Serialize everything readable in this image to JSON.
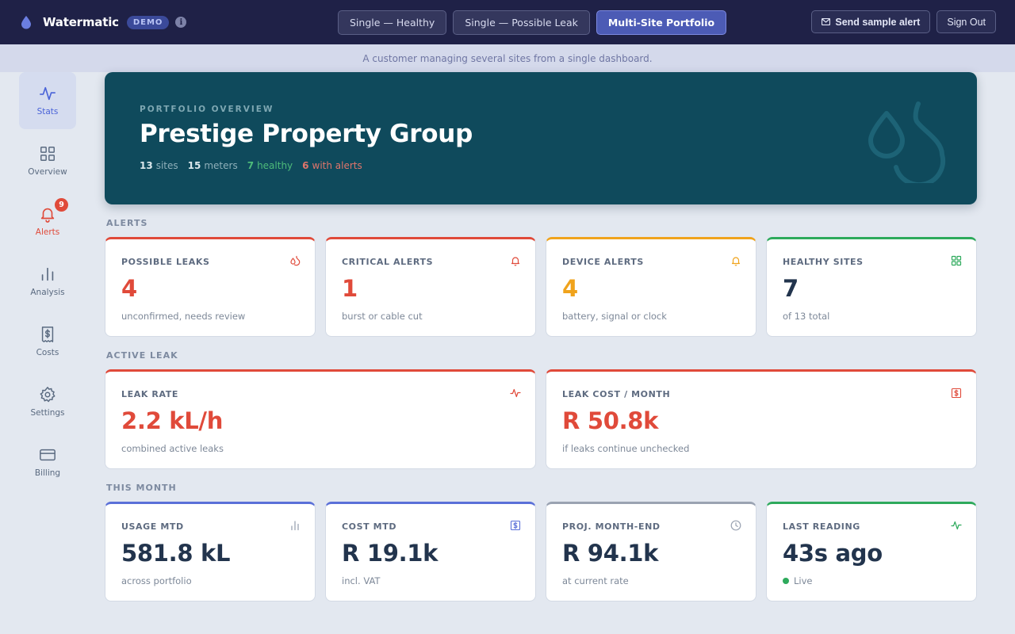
{
  "app": {
    "name": "Watermatic",
    "demo_badge": "DEMO",
    "info_glyph": "i"
  },
  "scenarios": [
    {
      "label": "Single — Healthy",
      "active": false
    },
    {
      "label": "Single — Possible Leak",
      "active": false
    },
    {
      "label": "Multi-Site Portfolio",
      "active": true
    }
  ],
  "actions": {
    "send_alert": "Send sample alert",
    "sign_out": "Sign Out"
  },
  "subtitle": "A customer managing several sites from a single dashboard.",
  "sidebar": {
    "items": [
      {
        "label": "Stats",
        "icon": "activity-icon"
      },
      {
        "label": "Overview",
        "icon": "grid-icon"
      },
      {
        "label": "Alerts",
        "icon": "bell-icon",
        "badge": "9"
      },
      {
        "label": "Analysis",
        "icon": "bar-chart-icon"
      },
      {
        "label": "Costs",
        "icon": "receipt-icon"
      },
      {
        "label": "Settings",
        "icon": "gear-icon"
      },
      {
        "label": "Billing",
        "icon": "credit-card-icon"
      }
    ]
  },
  "hero": {
    "eyebrow": "PORTFOLIO OVERVIEW",
    "title": "Prestige Property Group",
    "sites_count": "13",
    "sites_label": "sites",
    "meters_count": "15",
    "meters_label": "meters",
    "healthy_count": "7",
    "healthy_label": "healthy",
    "alerts_count": "6",
    "alerts_label": "with alerts"
  },
  "sections": {
    "alerts": "ALERTS",
    "active_leak": "ACTIVE LEAK",
    "this_month": "THIS MONTH"
  },
  "colors": {
    "red": "#e04a3a",
    "amber": "#f0a31c",
    "green": "#2eaa5c",
    "blue": "#5b70d8",
    "gray": "#9aa3b2",
    "navy": "#22344d"
  },
  "alert_cards": [
    {
      "title": "POSSIBLE LEAKS",
      "value": "4",
      "sub": "unconfirmed, needs review",
      "icon": "drops-icon"
    },
    {
      "title": "CRITICAL ALERTS",
      "value": "1",
      "sub": "burst or cable cut",
      "icon": "bell-icon"
    },
    {
      "title": "DEVICE ALERTS",
      "value": "4",
      "sub": "battery, signal or clock",
      "icon": "bell-icon"
    },
    {
      "title": "HEALTHY SITES",
      "value": "7",
      "sub": "of 13 total",
      "icon": "grid-icon"
    }
  ],
  "leak_cards": [
    {
      "title": "LEAK RATE",
      "value": "2.2 kL/h",
      "sub": "combined active leaks",
      "icon": "activity-icon"
    },
    {
      "title": "LEAK COST / MONTH",
      "value": "R 50.8k",
      "sub": "if leaks continue unchecked",
      "icon": "dollar-receipt-icon"
    }
  ],
  "month_cards": [
    {
      "title": "USAGE MTD",
      "value": "581.8 kL",
      "sub": "across portfolio",
      "icon": "bar-chart-icon"
    },
    {
      "title": "COST MTD",
      "value": "R 19.1k",
      "sub": "incl. VAT",
      "icon": "dollar-receipt-icon"
    },
    {
      "title": "PROJ. MONTH-END",
      "value": "R 94.1k",
      "sub": "at current rate",
      "icon": "clock-icon"
    },
    {
      "title": "LAST READING",
      "value": "43s ago",
      "sub": "Live",
      "icon": "activity-icon"
    }
  ]
}
